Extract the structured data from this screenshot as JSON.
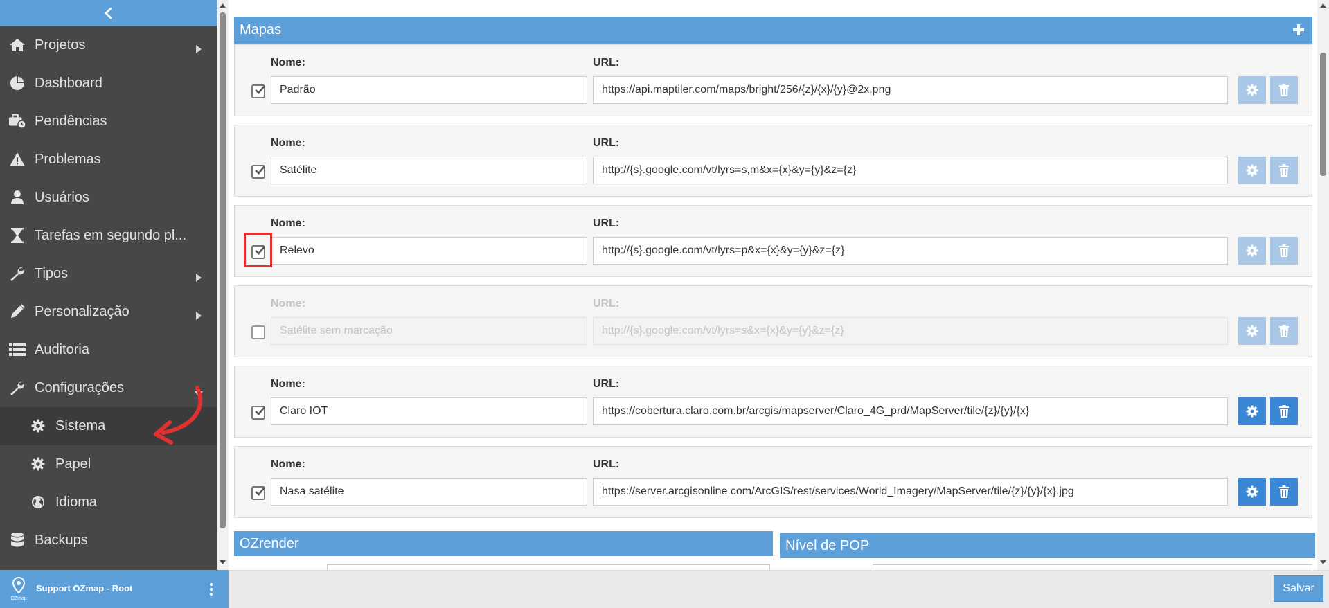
{
  "sidebar": {
    "items": [
      {
        "label": "Projetos",
        "icon": "home-icon",
        "arrow": "right"
      },
      {
        "label": "Dashboard",
        "icon": "pie-chart-icon"
      },
      {
        "label": "Pendências",
        "icon": "briefcase-clock-icon"
      },
      {
        "label": "Problemas",
        "icon": "warning-icon"
      },
      {
        "label": "Usuários",
        "icon": "user-icon"
      },
      {
        "label": "Tarefas em segundo pl...",
        "icon": "hourglass-icon"
      },
      {
        "label": "Tipos",
        "icon": "wrench-icon",
        "arrow": "right"
      },
      {
        "label": "Personalização",
        "icon": "pencil-icon",
        "arrow": "right"
      },
      {
        "label": "Auditoria",
        "icon": "list-icon"
      },
      {
        "label": "Configurações",
        "icon": "wrench-icon",
        "arrow": "down"
      },
      {
        "label": "Sistema",
        "icon": "gear-icon",
        "sub": true,
        "active": true
      },
      {
        "label": "Papel",
        "icon": "gear-icon",
        "sub": true
      },
      {
        "label": "Idioma",
        "icon": "globe-icon",
        "sub": true
      },
      {
        "label": "Backups",
        "icon": "database-icon"
      }
    ],
    "footer": {
      "user": "Support OZmap - Root",
      "logo_text": "OZmap"
    }
  },
  "mapas": {
    "title": "Mapas",
    "name_label": "Nome:",
    "url_label": "URL:",
    "rows": [
      {
        "checked": true,
        "enabled": true,
        "name": "Padrão",
        "url": "https://api.maptiler.com/maps/bright/256/{z}/{x}/{y}@2x.png",
        "buttons_active": false
      },
      {
        "checked": true,
        "enabled": true,
        "name": "Satélite",
        "url": "http://{s}.google.com/vt/lyrs=s,m&x={x}&y={y}&z={z}",
        "buttons_active": false
      },
      {
        "checked": true,
        "enabled": true,
        "name": "Relevo",
        "url": "http://{s}.google.com/vt/lyrs=p&x={x}&y={y}&z={z}",
        "buttons_active": false
      },
      {
        "checked": false,
        "enabled": false,
        "name": "Satélite sem marcação",
        "url": "http://{s}.google.com/vt/lyrs=s&x={x}&y={y}&z={z}",
        "buttons_active": false
      },
      {
        "checked": true,
        "enabled": true,
        "name": "Claro IOT",
        "url": "https://cobertura.claro.com.br/arcgis/mapserver/Claro_4G_prd/MapServer/tile/{z}/{y}/{x}",
        "buttons_active": true
      },
      {
        "checked": true,
        "enabled": true,
        "name": "Nasa satélite",
        "url": "https://server.arcgisonline.com/ArcGIS/rest/services/World_Imagery/MapServer/tile/{z}/{y}/{x}.jpg",
        "buttons_active": true
      }
    ]
  },
  "ozrender": {
    "title": "OZrender"
  },
  "nivel_pop": {
    "title": "Nível de POP"
  },
  "footer": {
    "save_label": "Salvar"
  },
  "colors": {
    "accent": "#5d9fd9",
    "button": "#3a87d6",
    "sidebar": "#474747",
    "annotation": "#e03030"
  }
}
